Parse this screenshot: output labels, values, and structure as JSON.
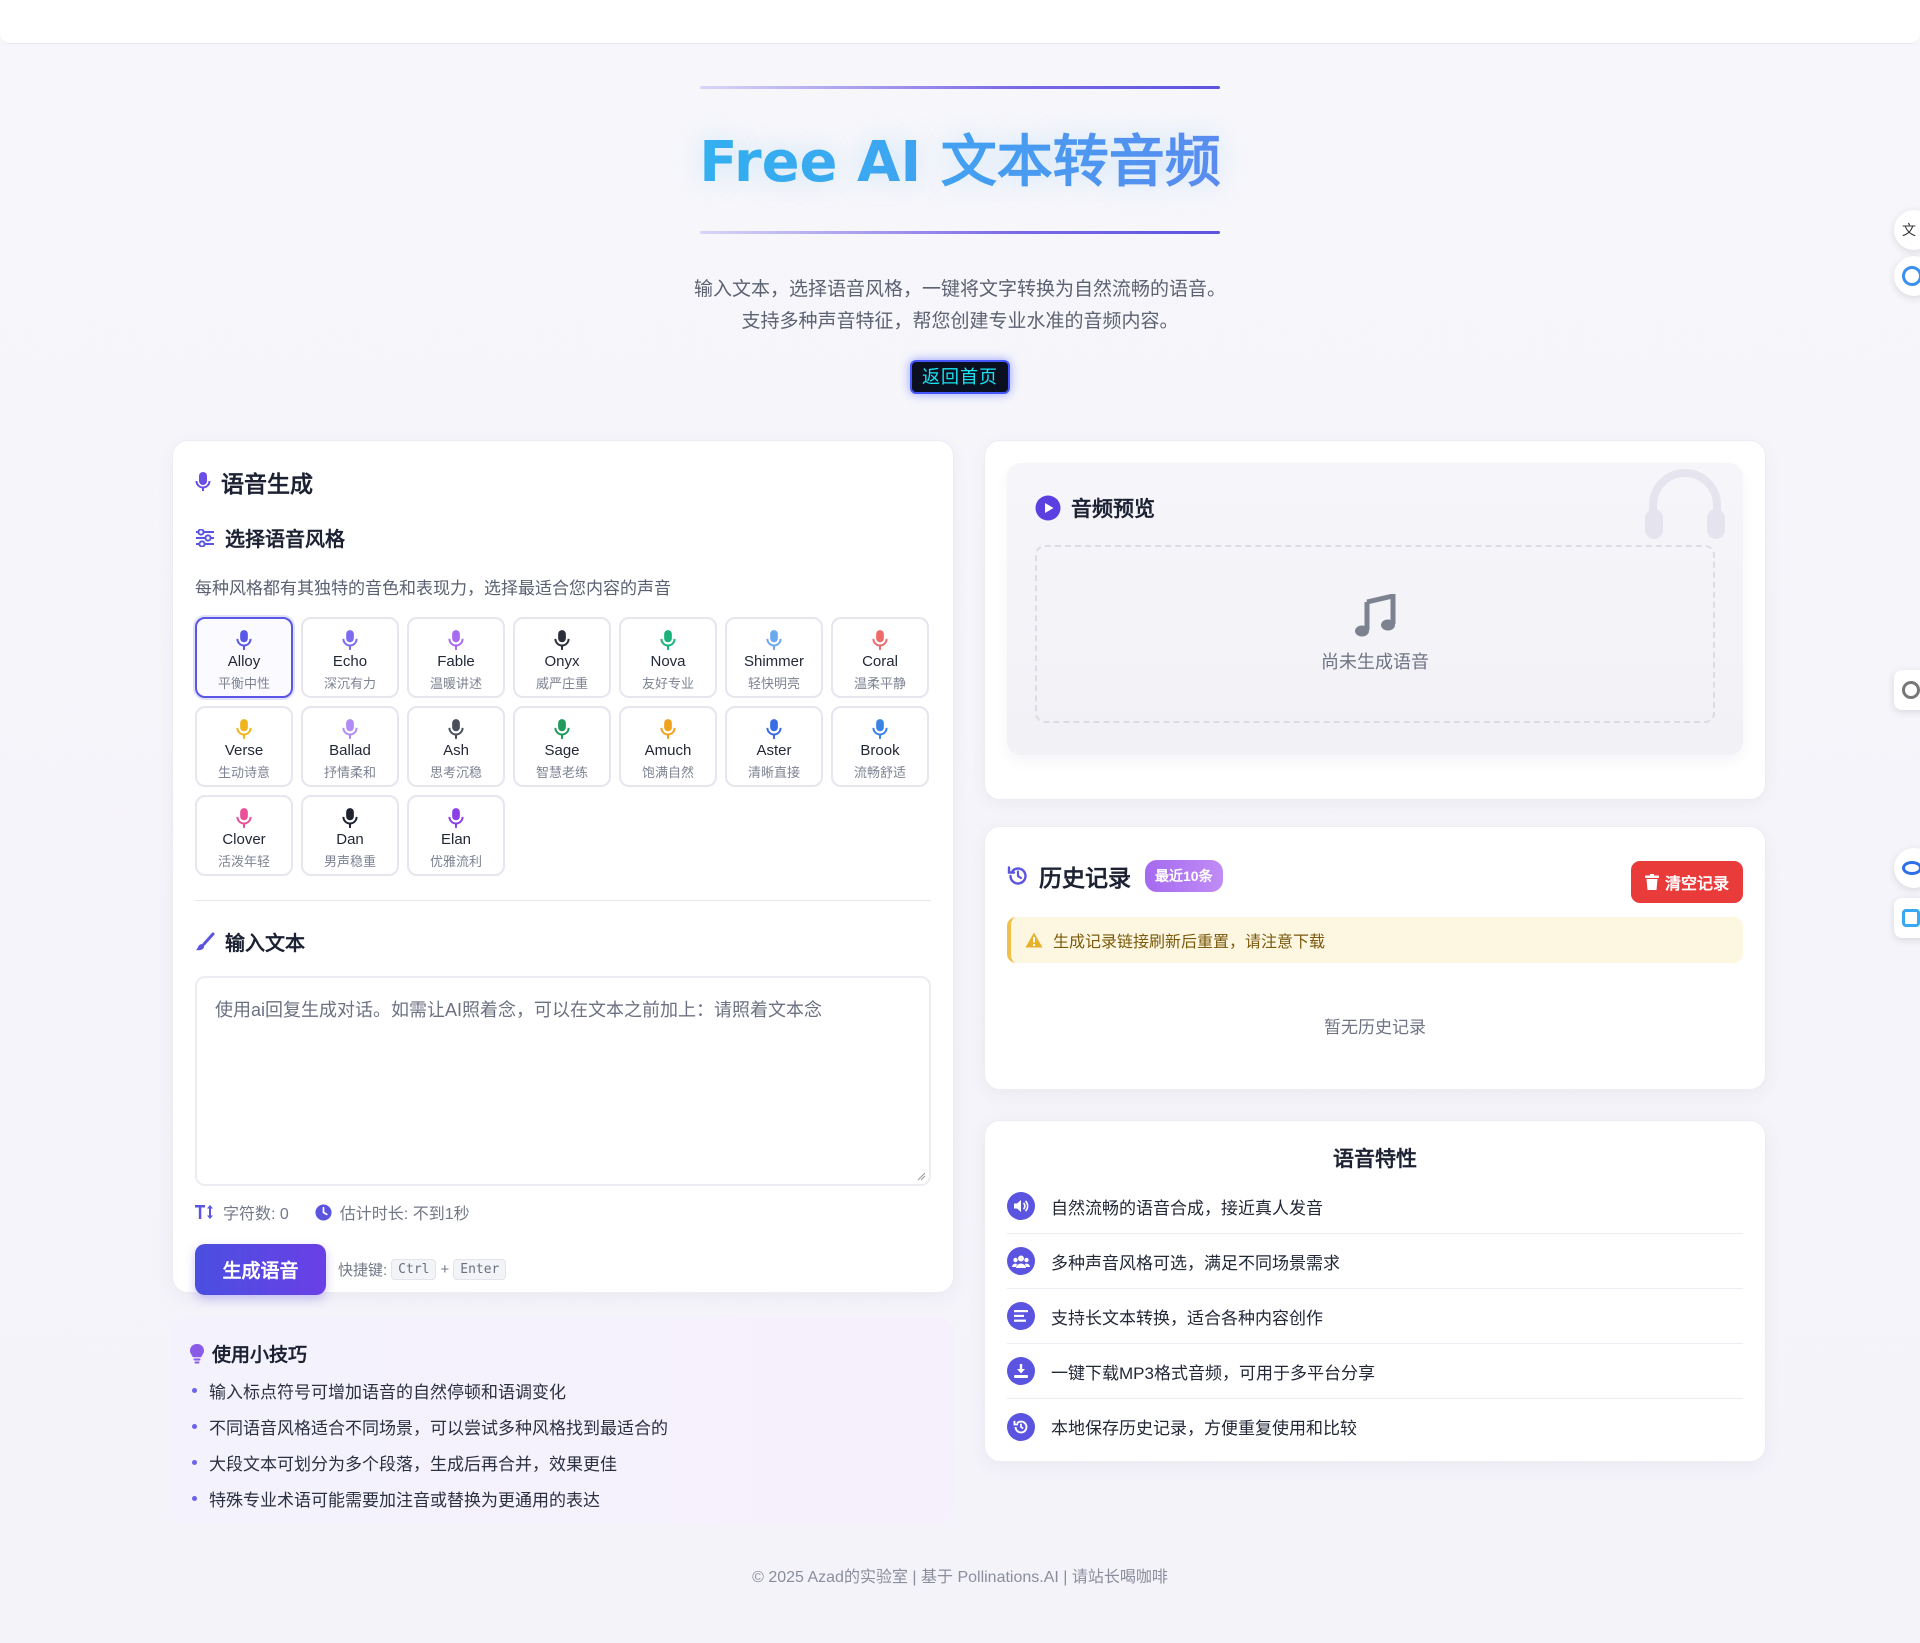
{
  "hero": {
    "title": "Free AI 文本转音频",
    "subtitle_line1": "输入文本，选择语音风格，一键将文字转换为自然流畅的语音。",
    "subtitle_line2": "支持多种声音特征，帮您创建专业水准的音频内容。",
    "home_button": "返回首页"
  },
  "voice_card": {
    "title": "语音生成",
    "style_title": "选择语音风格",
    "style_desc": "每种风格都有其独特的音色和表现力，选择最适合您内容的声音",
    "voices": [
      {
        "name": "Alloy",
        "desc": "平衡中性",
        "color": "#5b57e6",
        "selected": true
      },
      {
        "name": "Echo",
        "desc": "深沉有力",
        "color": "#7b6cf0",
        "selected": false
      },
      {
        "name": "Fable",
        "desc": "温暖讲述",
        "color": "#a86cf0",
        "selected": false
      },
      {
        "name": "Onyx",
        "desc": "威严庄重",
        "color": "#2a2f3a",
        "selected": false
      },
      {
        "name": "Nova",
        "desc": "友好专业",
        "color": "#19b27a",
        "selected": false
      },
      {
        "name": "Shimmer",
        "desc": "轻快明亮",
        "color": "#6aa8f0",
        "selected": false
      },
      {
        "name": "Coral",
        "desc": "温柔平静",
        "color": "#ef6a6a",
        "selected": false
      },
      {
        "name": "Verse",
        "desc": "生动诗意",
        "color": "#f0b41c",
        "selected": false
      },
      {
        "name": "Ballad",
        "desc": "抒情柔和",
        "color": "#b28cf5",
        "selected": false
      },
      {
        "name": "Ash",
        "desc": "思考沉稳",
        "color": "#4a4f5c",
        "selected": false
      },
      {
        "name": "Sage",
        "desc": "智慧老练",
        "color": "#1f9a5a",
        "selected": false
      },
      {
        "name": "Amuch",
        "desc": "饱满自然",
        "color": "#f0a21c",
        "selected": false
      },
      {
        "name": "Aster",
        "desc": "清晰直接",
        "color": "#3a6ce6",
        "selected": false
      },
      {
        "name": "Brook",
        "desc": "流畅舒适",
        "color": "#3a84e6",
        "selected": false
      },
      {
        "name": "Clover",
        "desc": "活泼年轻",
        "color": "#e8509a",
        "selected": false
      },
      {
        "name": "Dan",
        "desc": "男声稳重",
        "color": "#1f2330",
        "selected": false
      },
      {
        "name": "Elan",
        "desc": "优雅流利",
        "color": "#8a40e6",
        "selected": false
      }
    ],
    "input_title": "输入文本",
    "textarea_placeholder": "使用ai回复生成对话。如需让AI照着念，可以在文本之前加上：请照着文本念",
    "char_count": "字符数: 0",
    "est_time": "估计时长: 不到1秒",
    "generate_button": "生成语音",
    "shortcut_label": "快捷键:",
    "shortcut_key1": "Ctrl",
    "shortcut_plus": "+",
    "shortcut_key2": "Enter"
  },
  "tips": {
    "title": "使用小技巧",
    "items": [
      "输入标点符号可增加语音的自然停顿和语调变化",
      "不同语音风格适合不同场景，可以尝试多种风格找到最适合的",
      "大段文本可划分为多个段落，生成后再合并，效果更佳",
      "特殊专业术语可能需要加注音或替换为更通用的表达"
    ]
  },
  "preview": {
    "title": "音频预览",
    "empty_text": "尚未生成语音"
  },
  "history": {
    "title": "历史记录",
    "badge": "最近10条",
    "clear_button": "清空记录",
    "warning": "生成记录链接刷新后重置，请注意下载",
    "empty_text": "暂无历史记录"
  },
  "features": {
    "title": "语音特性",
    "items": [
      {
        "text": "自然流畅的语音合成，接近真人发音",
        "icon": "volume-icon"
      },
      {
        "text": "多种声音风格可选，满足不同场景需求",
        "icon": "users-icon"
      },
      {
        "text": "支持长文本转换，适合各种内容创作",
        "icon": "text-lines-icon"
      },
      {
        "text": "一键下载MP3格式音频，可用于多平台分享",
        "icon": "download-icon"
      },
      {
        "text": "本地保存历史记录，方便重复使用和比较",
        "icon": "history-icon"
      }
    ]
  },
  "footer": {
    "text": "© 2025 Azad的实验室 | 基于 Pollinations.AI | 请站长喝咖啡"
  },
  "colors": {
    "accent": "#5b54e0",
    "danger": "#ea3b3b",
    "warning_bg": "#fdf7e1"
  }
}
